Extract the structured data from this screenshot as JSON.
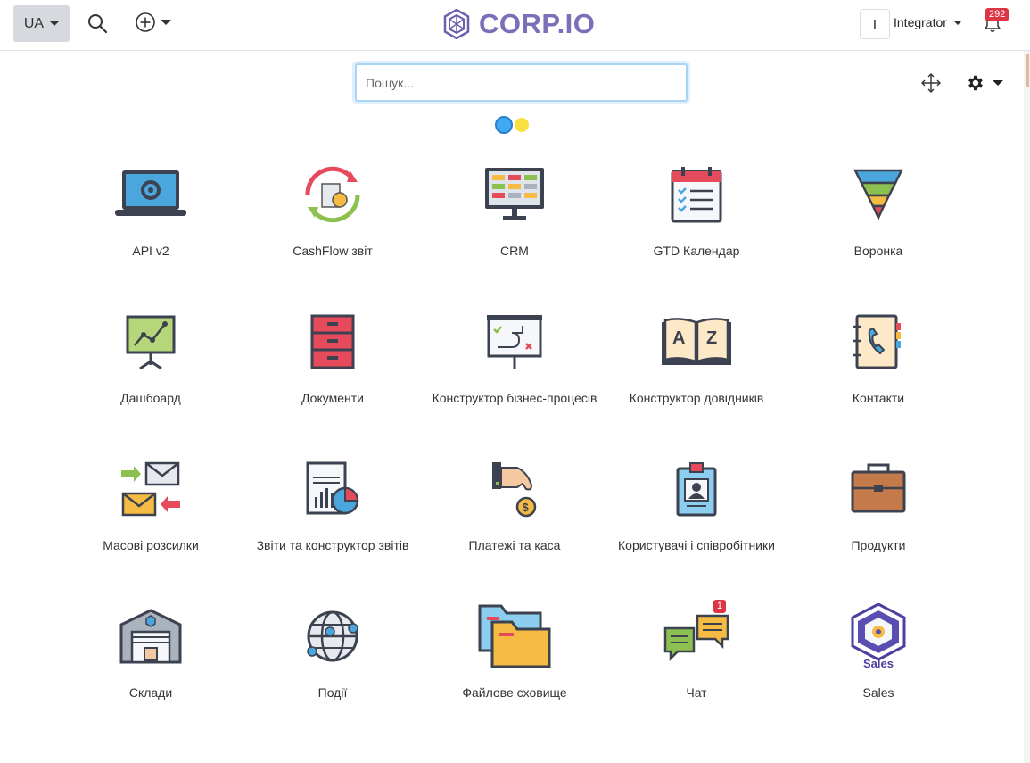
{
  "header": {
    "language": "UA",
    "logo_text": "CORP.IO",
    "user_initial": "I",
    "user_name": "Integrator",
    "notifications_count": "292"
  },
  "search": {
    "placeholder": "Пошук..."
  },
  "icons": {
    "search": "search-icon",
    "add": "plus-circle-icon",
    "bell": "bell-icon",
    "move": "move-icon",
    "settings": "gear-icon"
  },
  "apps": [
    {
      "label": "API v2",
      "icon": "laptop-gear-icon"
    },
    {
      "label": "CashFlow звіт",
      "icon": "cashflow-cycle-icon"
    },
    {
      "label": "CRM",
      "icon": "crm-monitor-icon"
    },
    {
      "label": "GTD Календар",
      "icon": "calendar-checklist-icon"
    },
    {
      "label": "Воронка",
      "icon": "funnel-icon"
    },
    {
      "label": "Дашбоард",
      "icon": "dashboard-chart-icon"
    },
    {
      "label": "Документи",
      "icon": "file-cabinet-icon"
    },
    {
      "label": "Конструктор бізнес-процесів",
      "icon": "process-board-icon"
    },
    {
      "label": "Конструктор довідників",
      "icon": "dictionary-book-icon"
    },
    {
      "label": "Контакти",
      "icon": "contacts-phone-icon"
    },
    {
      "label": "Масові розсилки",
      "icon": "mail-exchange-icon"
    },
    {
      "label": "Звіти та конструктор звітів",
      "icon": "report-chart-icon"
    },
    {
      "label": "Платежі та каса",
      "icon": "payment-hand-icon"
    },
    {
      "label": "Користувачі і співробітники",
      "icon": "id-badge-icon"
    },
    {
      "label": "Продукти",
      "icon": "briefcase-icon"
    },
    {
      "label": "Склади",
      "icon": "warehouse-icon"
    },
    {
      "label": "Події",
      "icon": "globe-network-icon"
    },
    {
      "label": "Файлове сховище",
      "icon": "folders-icon"
    },
    {
      "label": "Чат",
      "icon": "chat-bubbles-icon",
      "badge": "1"
    },
    {
      "label": "Sales",
      "icon": "sales-logo-icon",
      "icon_text": "Sales"
    }
  ]
}
